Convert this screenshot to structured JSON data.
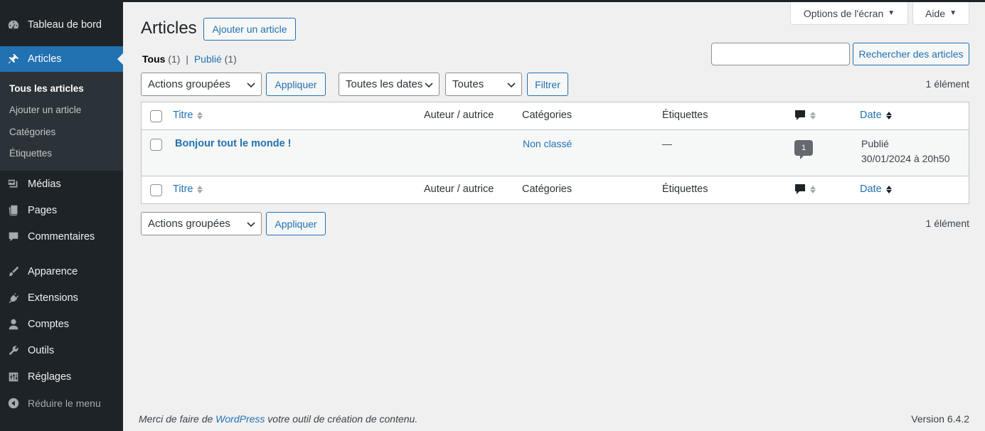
{
  "sidebar": {
    "dashboard": "Tableau de bord",
    "articles": "Articles",
    "submenu": [
      "Tous les articles",
      "Ajouter un article",
      "Catégories",
      "Étiquettes"
    ],
    "media": "Médias",
    "pages": "Pages",
    "comments": "Commentaires",
    "appearance": "Apparence",
    "plugins": "Extensions",
    "users": "Comptes",
    "tools": "Outils",
    "settings": "Réglages",
    "collapse": "Réduire le menu"
  },
  "header": {
    "screen_options": "Options de l'écran",
    "help": "Aide",
    "title": "Articles",
    "add_new": "Ajouter un article"
  },
  "filters": {
    "all_label": "Tous",
    "all_count": "(1)",
    "separator": "|",
    "published_label": "Publié",
    "published_count": "(1)",
    "search_value": "",
    "search_button": "Rechercher des articles",
    "bulk_actions": "Actions groupées",
    "apply": "Appliquer",
    "dates": "Toutes les dates",
    "categories": "Toutes",
    "filter": "Filtrer",
    "count": "1 élément"
  },
  "table": {
    "columns": {
      "title": "Titre",
      "author": "Auteur / autrice",
      "categories": "Catégories",
      "tags": "Étiquettes",
      "date": "Date"
    },
    "rows": [
      {
        "title": "Bonjour tout le monde !",
        "author": "",
        "category": "Non classé",
        "tags": "—",
        "comments": "1",
        "status": "Publié",
        "date": "30/01/2024 à 20h50"
      }
    ]
  },
  "footer": {
    "thanks_prefix": "Merci de faire de ",
    "thanks_link": "WordPress",
    "thanks_suffix": " votre outil de création de contenu.",
    "version": "Version 6.4.2"
  },
  "colors": {
    "sidebar_bg": "#1d2327",
    "accent": "#2271b1",
    "page_bg": "#f0f0f1"
  }
}
